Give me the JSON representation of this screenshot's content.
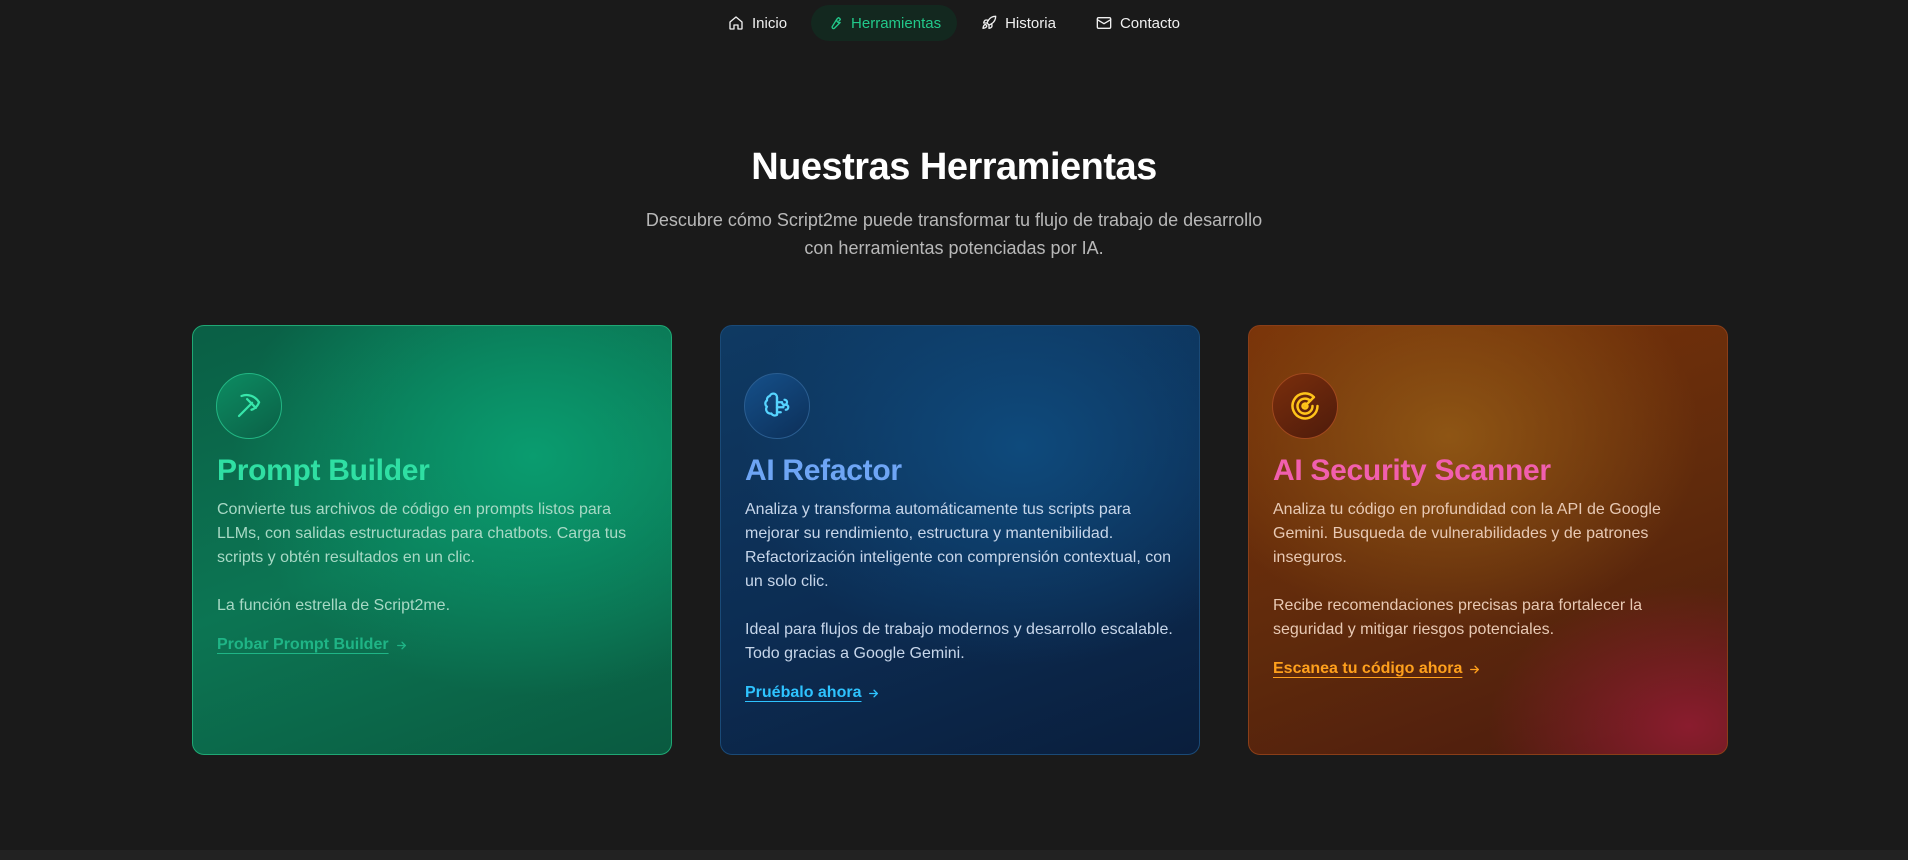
{
  "nav": {
    "items": [
      {
        "label": "Inicio",
        "icon": "home-icon"
      },
      {
        "label": "Herramientas",
        "icon": "wrench-icon",
        "active": true
      },
      {
        "label": "Historia",
        "icon": "rocket-icon"
      },
      {
        "label": "Contacto",
        "icon": "mail-icon"
      }
    ]
  },
  "section": {
    "title": "Nuestras Herramientas",
    "subtitle_line1": "Descubre cómo Script2me puede transformar tu flujo de trabajo de desarrollo",
    "subtitle_line2": "con herramientas potenciadas por IA."
  },
  "cards": [
    {
      "title": "Prompt Builder",
      "icon": "pickaxe-icon",
      "paragraph1": "Convierte tus archivos de código en prompts listos para LLMs, con salidas estructuradas para chatbots. Carga tus scripts y obtén resultados en un clic.",
      "paragraph2": "La función estrella de Script2me.",
      "cta": "Probar Prompt Builder",
      "accent": "#2fdfa3"
    },
    {
      "title": "AI Refactor",
      "icon": "brain-icon",
      "paragraph1": "Analiza y transforma automáticamente tus scripts para mejorar su rendimiento, estructura y mantenibilidad. Refactorización inteligente con comprensión contextual, con un solo clic.",
      "paragraph2": "Ideal para flujos de trabajo modernos y desarrollo escalable. Todo gracias a Google Gemini.",
      "cta": "Pruébalo ahora",
      "accent": "#6ea5f5"
    },
    {
      "title": "AI Security Scanner",
      "icon": "radar-icon",
      "paragraph1": "Analiza tu código en profundidad con la API de Google Gemini. Busqueda de vulnerabilidades y de patrones inseguros.",
      "paragraph2": "Recibe recomendaciones precisas para fortalecer la seguridad y mitigar riesgos potenciales.",
      "cta": "Escanea tu código ahora",
      "accent": "#f15fae"
    }
  ]
}
